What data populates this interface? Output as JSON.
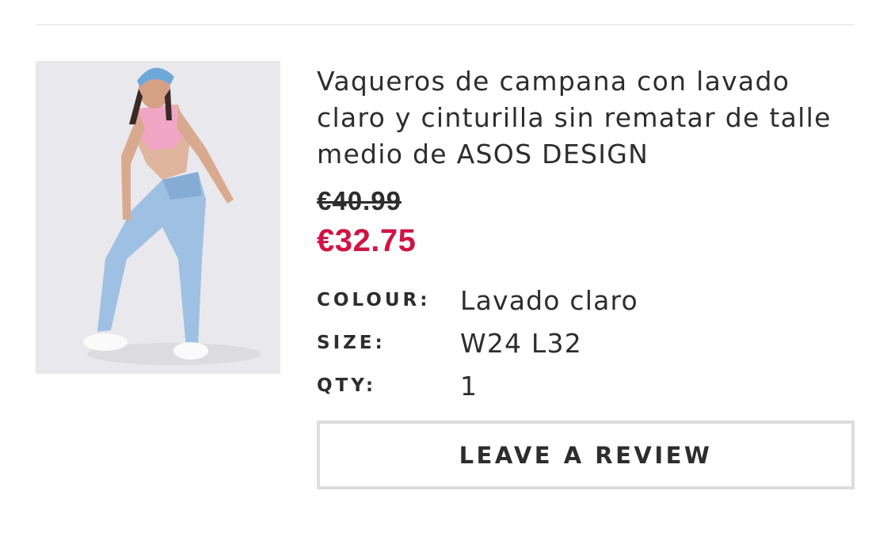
{
  "product": {
    "title": "Vaqueros de campana con lavado claro y cinturilla sin rematar de talle medio de ASOS DESIGN",
    "price_old": "€40.99",
    "price_now": "€32.75",
    "sale_color": "#d01345",
    "attributes": [
      {
        "label": "COLOUR:",
        "value": "Lavado claro"
      },
      {
        "label": "SIZE:",
        "value": "W24 L32"
      },
      {
        "label": "QTY:",
        "value": "1"
      }
    ]
  },
  "actions": {
    "review_label": "LEAVE A REVIEW"
  }
}
